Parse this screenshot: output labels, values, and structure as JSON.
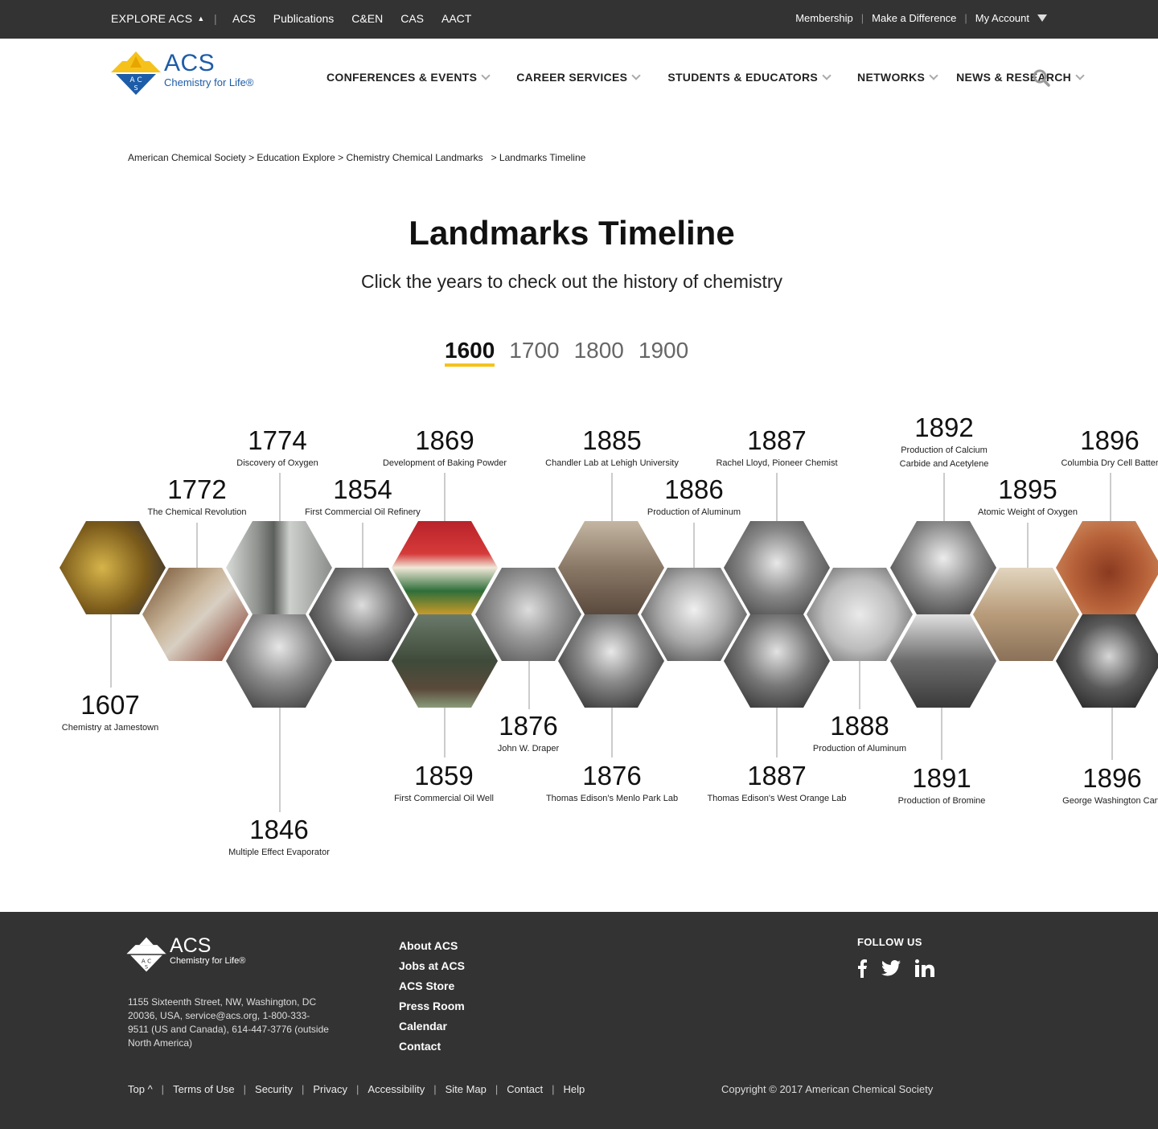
{
  "topbar": {
    "explore_label": "EXPLORE ACS",
    "links": [
      "ACS",
      "Publications",
      "C&EN",
      "CAS",
      "AACT"
    ],
    "right_links": [
      "Membership",
      "Make a Difference",
      "My Account"
    ]
  },
  "logo": {
    "name": "ACS",
    "tagline": "Chemistry for Life®"
  },
  "nav": [
    "CONFERENCES & EVENTS",
    "CAREER SERVICES",
    "STUDENTS & EDUCATORS",
    "NETWORKS",
    "NEWS & RESEARCH"
  ],
  "breadcrumb": [
    "American Chemical Society",
    "Education Explore",
    "Chemistry Chemical Landmarks",
    "Landmarks Timeline"
  ],
  "page": {
    "title": "Landmarks Timeline",
    "subtitle": "Click the years to check out the history of chemistry"
  },
  "century_tabs": [
    "1600",
    "1700",
    "1800",
    "1900"
  ],
  "active_tab": "1600",
  "landmarks": [
    {
      "year": "1607",
      "event": "Chemistry at Jamestown"
    },
    {
      "year": "1772",
      "event": "The Chemical Revolution"
    },
    {
      "year": "1774",
      "event": "Discovery of Oxygen"
    },
    {
      "year": "1846",
      "event": "Multiple Effect Evaporator"
    },
    {
      "year": "1854",
      "event": "First Commercial Oil Refinery"
    },
    {
      "year": "1869",
      "event": "Development of Baking Powder"
    },
    {
      "year": "1859",
      "event": "First Commercial Oil Well"
    },
    {
      "year": "1876",
      "event": "John W. Draper"
    },
    {
      "year": "1885",
      "event": "Chandler Lab at Lehigh University"
    },
    {
      "year": "1876",
      "event": "Thomas Edison's Menlo Park Lab"
    },
    {
      "year": "1886",
      "event": "Production of Aluminum"
    },
    {
      "year": "1887",
      "event": "Rachel Lloyd, Pioneer Chemist"
    },
    {
      "year": "1887",
      "event": "Thomas Edison's West Orange Lab"
    },
    {
      "year": "1888",
      "event": "Production of Aluminum"
    },
    {
      "year": "1892",
      "event": "Production of Calcium Carbide and Acetylene"
    },
    {
      "year": "1891",
      "event": "Production of Bromine"
    },
    {
      "year": "1895",
      "event": "Atomic Weight of Oxygen"
    },
    {
      "year": "1896",
      "event": "Columbia Dry Cell Batter"
    },
    {
      "year": "1896",
      "event": "George Washington Carv"
    }
  ],
  "footer": {
    "logo_name": "ACS",
    "logo_tagline": "Chemistry for Life®",
    "address": "1155 Sixteenth Street, NW, Washington, DC 20036, USA, service@acs.org, 1-800-333-9511 (US and Canada), 614-447-3776 (outside North America)",
    "links": [
      "About ACS",
      "Jobs at ACS",
      "ACS Store",
      "Press Room",
      "Calendar",
      "Contact"
    ],
    "follow_label": "FOLLOW US",
    "social": [
      "facebook-icon",
      "twitter-icon",
      "linkedin-icon"
    ],
    "bottom_links": [
      "Top ^",
      "Terms of Use",
      "Security",
      "Privacy",
      "Accessibility",
      "Site Map",
      "Contact",
      "Help"
    ],
    "copyright": "Copyright © 2017 American Chemical Society"
  },
  "colors": {
    "accent": "#f5c21b",
    "brand": "#1d5ca8",
    "dark": "#333333"
  }
}
